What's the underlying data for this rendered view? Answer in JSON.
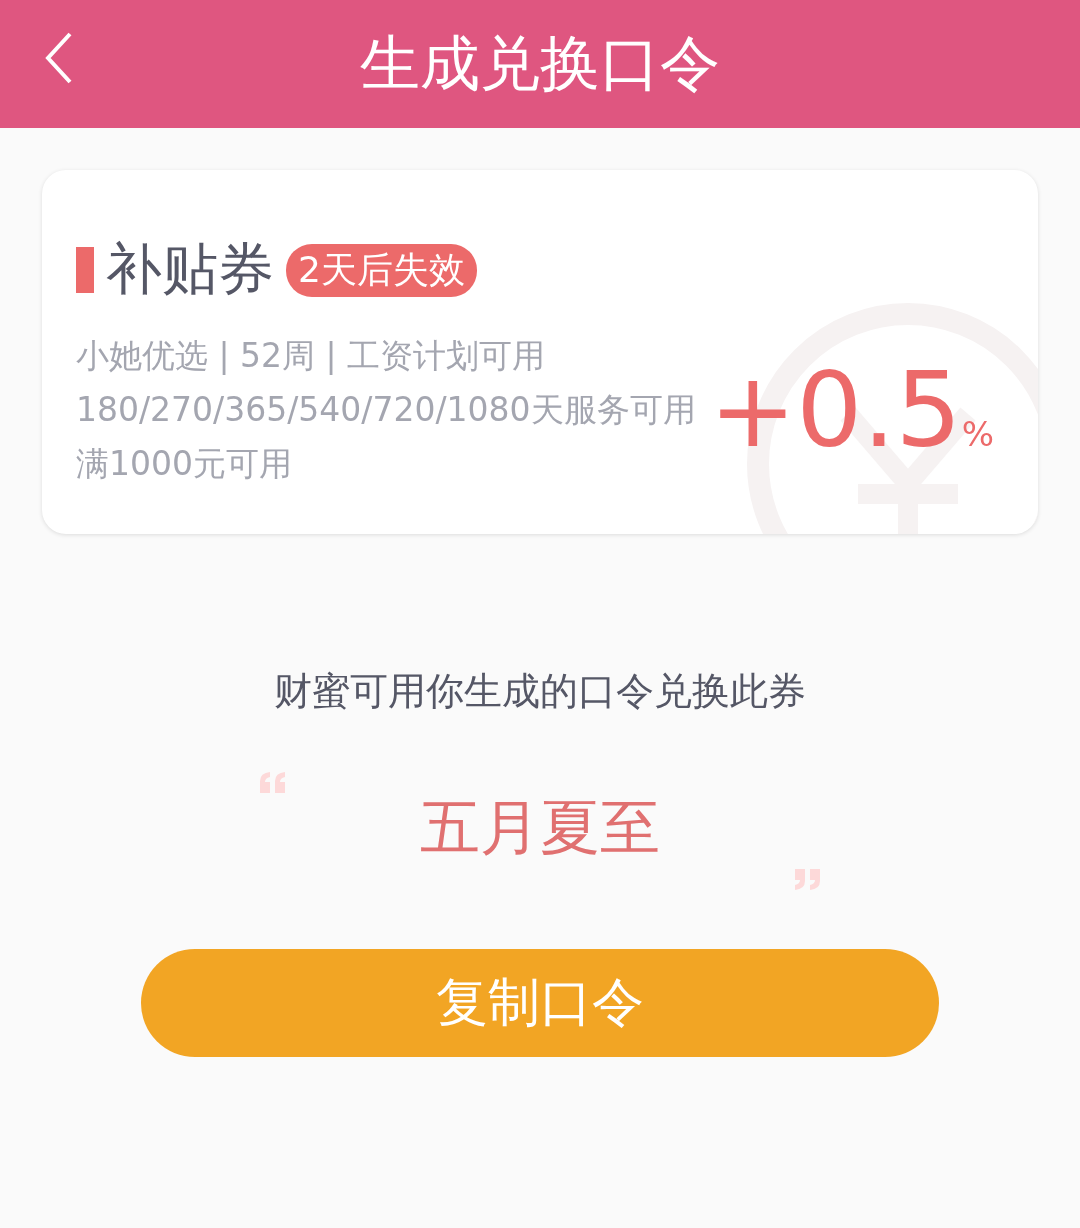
{
  "header": {
    "title": "生成兑换口令"
  },
  "coupon": {
    "title": "补贴券",
    "badge": "2天后失效",
    "conditions": [
      "小她优选 | 52周 | 工资计划可用",
      "180/270/365/540/720/1080天服务可用",
      "满1000元可用"
    ],
    "value": "+0.5",
    "unit": "%"
  },
  "hint": "财蜜可用你生成的口令兑换此券",
  "code": "五月夏至",
  "button": {
    "label": "复制口令"
  }
}
